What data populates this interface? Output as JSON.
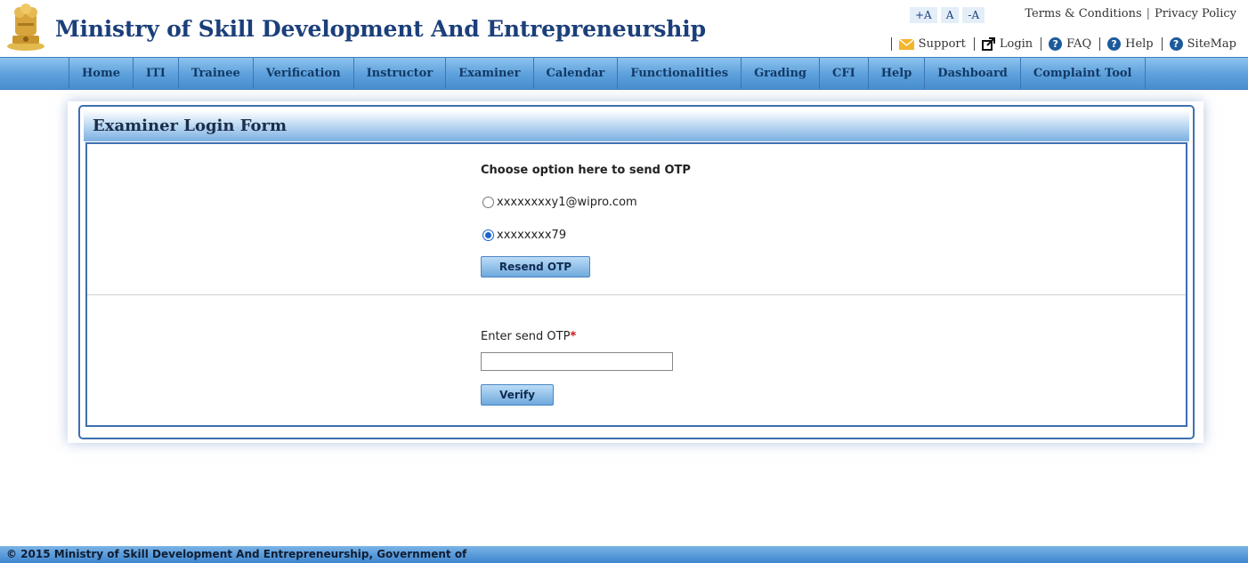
{
  "header": {
    "title": "Ministry of Skill Development And Entrepreneurship",
    "font_controls": [
      "+A",
      "A",
      "-A"
    ],
    "top_links": {
      "terms": "Terms & Conditions",
      "privacy": "Privacy Policy"
    },
    "util": {
      "support": "Support",
      "login": "Login",
      "faq": "FAQ",
      "help": "Help",
      "sitemap": "SiteMap"
    }
  },
  "nav": {
    "items": [
      "Home",
      "ITI",
      "Trainee",
      "Verification",
      "Instructor",
      "Examiner",
      "Calendar",
      "Functionalities",
      "Grading",
      "CFI",
      "Help",
      "Dashboard",
      "Complaint Tool"
    ]
  },
  "form": {
    "title": "Examiner Login Form",
    "choose_label": "Choose option here to send OTP",
    "options": [
      {
        "label": "xxxxxxxxy1@wipro.com",
        "checked": false
      },
      {
        "label": "xxxxxxxx79",
        "checked": true
      }
    ],
    "resend_label": "Resend OTP",
    "otp_label": "Enter send OTP",
    "required_mark": "*",
    "otp_value": "",
    "verify_label": "Verify"
  },
  "footer": {
    "text": "© 2015 Ministry of Skill Development And Entrepreneurship, Government of"
  },
  "colors": {
    "brand_blue": "#1b3f7a",
    "nav_blue": "#5b9fdb",
    "panel_border": "#3e6fb0",
    "required": "#d01010"
  },
  "icons": {
    "emblem": "national-emblem-icon",
    "support": "envelope-icon",
    "login": "external-link-icon",
    "faq": "question-circle-icon",
    "help": "question-circle-icon",
    "sitemap": "question-circle-icon"
  }
}
